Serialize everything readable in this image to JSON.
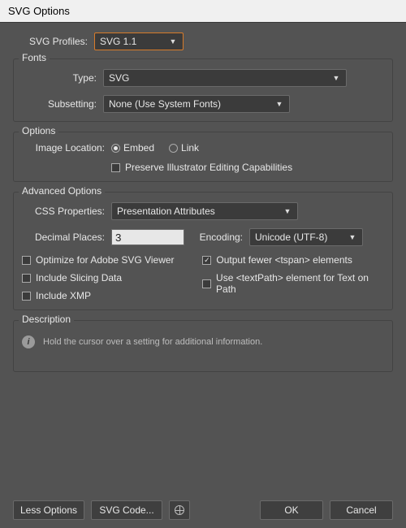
{
  "title": "SVG Options",
  "profiles": {
    "label": "SVG Profiles:",
    "value": "SVG 1.1"
  },
  "fonts": {
    "title": "Fonts",
    "type_label": "Type:",
    "type_value": "SVG",
    "subset_label": "Subsetting:",
    "subset_value": "None (Use System Fonts)"
  },
  "options": {
    "title": "Options",
    "img_loc_label": "Image Location:",
    "embed": "Embed",
    "link": "Link",
    "preserve": "Preserve Illustrator Editing Capabilities"
  },
  "advanced": {
    "title": "Advanced Options",
    "css_label": "CSS Properties:",
    "css_value": "Presentation Attributes",
    "decimal_label": "Decimal Places:",
    "decimal_value": "3",
    "encoding_label": "Encoding:",
    "encoding_value": "Unicode (UTF-8)",
    "optimize": "Optimize for Adobe SVG Viewer",
    "output_fewer": "Output fewer <tspan> elements",
    "slicing": "Include Slicing Data",
    "textpath": "Use <textPath> element for Text on Path",
    "xmp": "Include XMP"
  },
  "description": {
    "title": "Description",
    "hint": "Hold the cursor over a setting for additional information."
  },
  "footer": {
    "less": "Less Options",
    "svgcode": "SVG Code...",
    "ok": "OK",
    "cancel": "Cancel"
  }
}
